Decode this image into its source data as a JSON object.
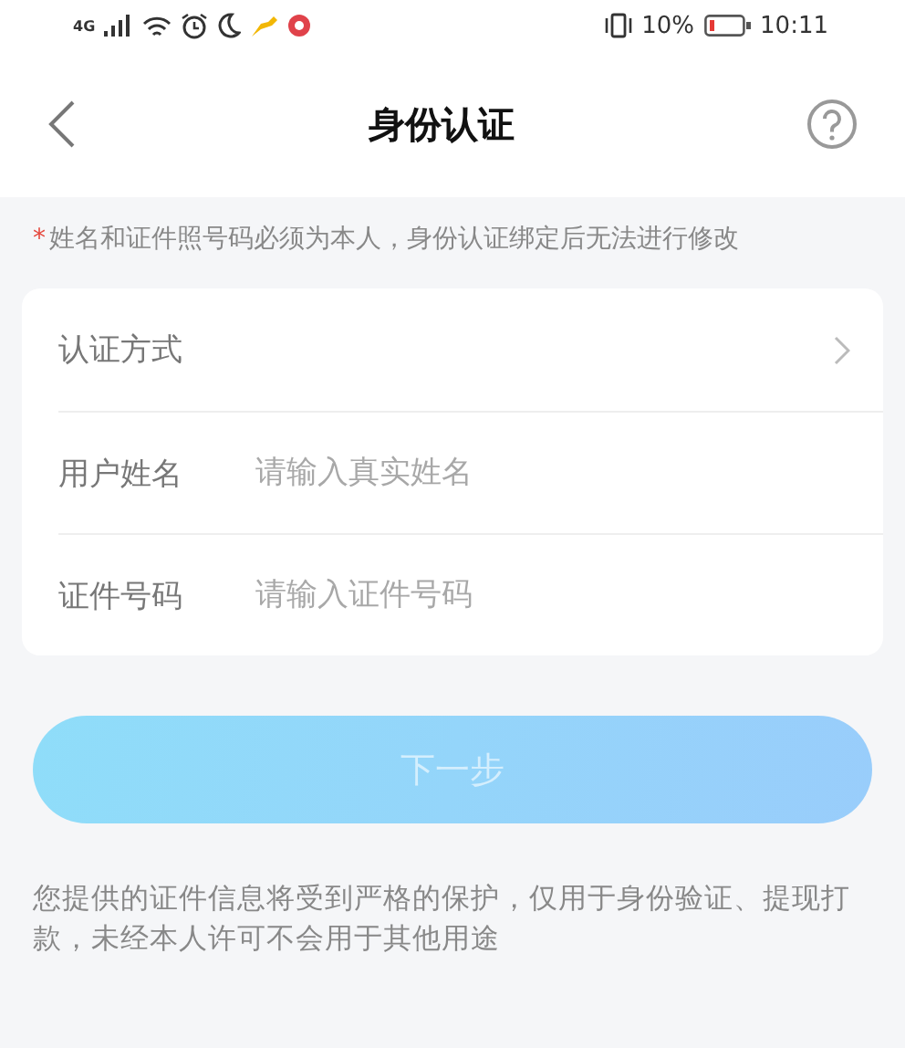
{
  "status_bar": {
    "network": "4G",
    "battery_percent": "10%",
    "time": "10:11"
  },
  "header": {
    "title": "身份认证"
  },
  "notice": {
    "mark": "*",
    "text": "姓名和证件照号码必须为本人，身份认证绑定后无法进行修改"
  },
  "form": [
    {
      "kind": "select",
      "label": "认证方式"
    },
    {
      "kind": "input",
      "label": "用户姓名",
      "placeholder": "请输入真实姓名"
    },
    {
      "kind": "input",
      "label": "证件号码",
      "placeholder": "请输入证件号码"
    }
  ],
  "next_button": {
    "label": "下一步",
    "disabled": true
  },
  "footer_note": "您提供的证件信息将受到严格的保护，仅用于身份验证、提现打款，未经本人许可不会用于其他用途"
}
